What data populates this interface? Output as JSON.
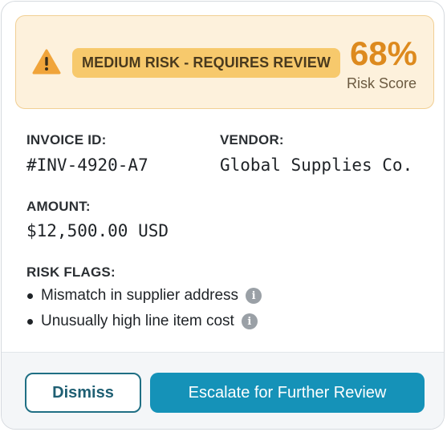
{
  "banner": {
    "risk_label": "MEDIUM RISK - REQUIRES REVIEW",
    "score_value": "68%",
    "score_label": "Risk Score",
    "icon": "warning-triangle-icon",
    "colors": {
      "background": "#fdf1dc",
      "pill": "#f7c96c",
      "score": "#dd8a1e"
    }
  },
  "invoice": {
    "label": "INVOICE ID:",
    "value": "#INV-4920-A7"
  },
  "vendor": {
    "label": "VENDOR:",
    "value": "Global Supplies Co."
  },
  "amount": {
    "label": "AMOUNT:",
    "value": "$12,500.00 USD"
  },
  "risk_flags": {
    "label": "RISK FLAGS:",
    "items": [
      {
        "text": "Mismatch in supplier address",
        "icon": "info-icon"
      },
      {
        "text": "Unusually high line item cost",
        "icon": "info-icon"
      }
    ]
  },
  "actions": {
    "dismiss_label": "Dismiss",
    "escalate_label": "Escalate for Further Review",
    "colors": {
      "dismiss_border": "#1f6f84",
      "escalate_bg": "#1592b8"
    }
  }
}
